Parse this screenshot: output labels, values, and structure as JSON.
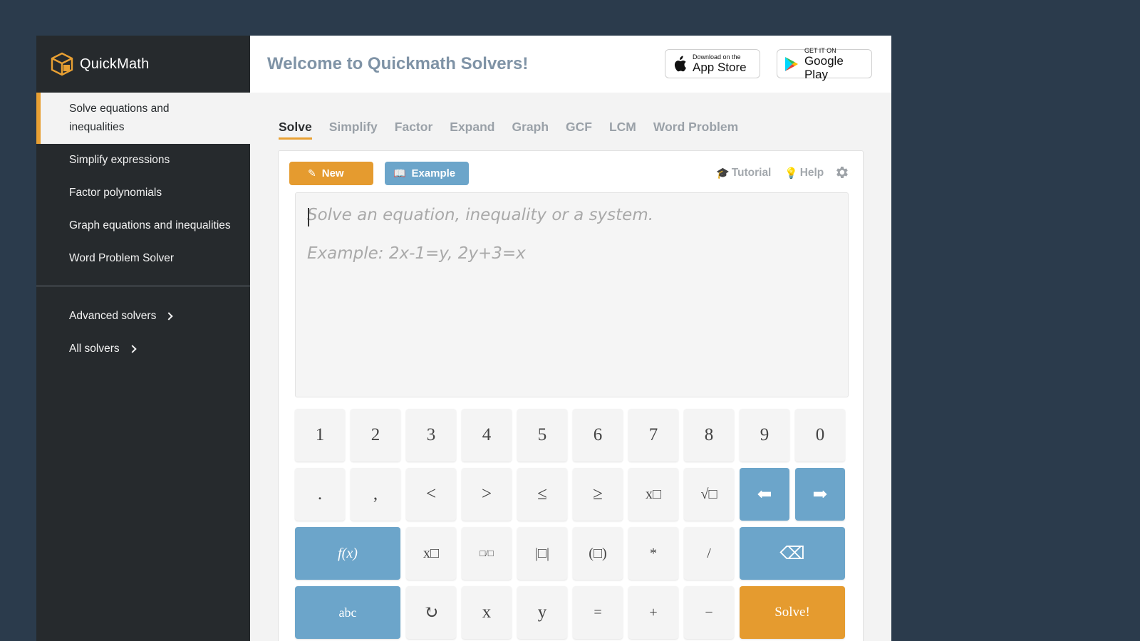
{
  "brand": {
    "name": "QuickMath"
  },
  "sidebar": {
    "items": [
      {
        "label": "Solve equations and inequalities",
        "active": true
      },
      {
        "label": "Simplify expressions"
      },
      {
        "label": "Factor polynomials"
      },
      {
        "label": "Graph equations and inequalities"
      },
      {
        "label": "Word Problem Solver"
      }
    ],
    "more": [
      {
        "label": "Advanced solvers"
      },
      {
        "label": "All solvers"
      }
    ]
  },
  "header": {
    "title": "Welcome to Quickmath Solvers!",
    "app_store": {
      "small": "Download on the",
      "big": "App Store"
    },
    "google_play": {
      "small": "GET IT ON",
      "big": "Google Play"
    }
  },
  "tabs": [
    {
      "label": "Solve",
      "active": true
    },
    {
      "label": "Simplify"
    },
    {
      "label": "Factor"
    },
    {
      "label": "Expand"
    },
    {
      "label": "Graph"
    },
    {
      "label": "GCF"
    },
    {
      "label": "LCM"
    },
    {
      "label": "Word Problem"
    }
  ],
  "toolbar": {
    "new_label": "New",
    "example_label": "Example",
    "tutorial_label": "Tutorial",
    "help_label": "Help"
  },
  "editor": {
    "placeholder_line1": "Solve an equation, inequality or a system.",
    "placeholder_line2": "Example: 2x-1=y, 2y+3=x"
  },
  "keypad": {
    "row1": [
      "1",
      "2",
      "3",
      "4",
      "5",
      "6",
      "7",
      "8",
      "9",
      "0"
    ],
    "row2": [
      ".",
      ",",
      "<",
      ">",
      "≤",
      "≥",
      "x□",
      "√□",
      "⬅",
      "➡"
    ],
    "row3": [
      "f(x)",
      "x□",
      "□/□",
      "|□|",
      "(□)",
      "*",
      "/",
      "⌫"
    ],
    "row4": [
      "abc",
      "↻",
      "x",
      "y",
      "=",
      "+",
      "−",
      "Solve!"
    ]
  },
  "colors": {
    "background": "#2b3b4c",
    "sidebar": "#262a2d",
    "accent_orange": "#e59b2f",
    "accent_blue": "#6ca5ca",
    "title": "#7f93a6"
  }
}
